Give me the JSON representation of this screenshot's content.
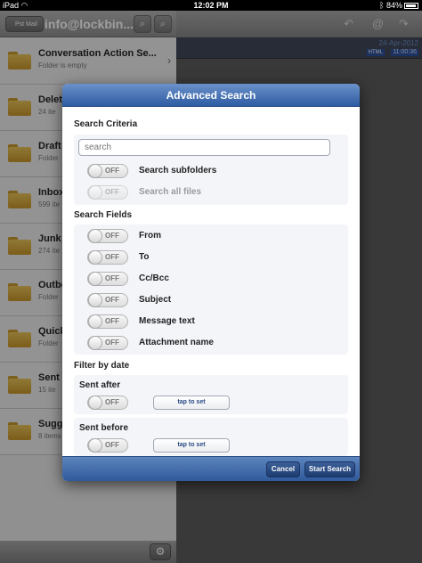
{
  "status_bar": {
    "device": "iPad",
    "time": "12:02 PM",
    "battery": "84%"
  },
  "left_pane": {
    "back_label": "Pst Mail",
    "title": "info@lockbin...",
    "folders": [
      {
        "name": "Conversation Action Se...",
        "sub": "Folder is empty"
      },
      {
        "name": "Delet",
        "sub": "24 ite"
      },
      {
        "name": "Draft",
        "sub": "Folder"
      },
      {
        "name": "Inbox",
        "sub": "599 ite"
      },
      {
        "name": "Junk",
        "sub": "274 ite"
      },
      {
        "name": "Outbo",
        "sub": "Folder"
      },
      {
        "name": "Quick",
        "sub": "Folder"
      },
      {
        "name": "Sent",
        "sub": "15 ite"
      },
      {
        "name": "Sugg",
        "sub": "8 items"
      }
    ]
  },
  "right_pane": {
    "date": "24-Apr-2012",
    "format_badge": "HTML",
    "time": "11:00:36"
  },
  "dialog": {
    "title": "Advanced Search",
    "search_criteria_label": "Search Criteria",
    "search_placeholder": "search",
    "off_label": "OFF",
    "criteria_options": [
      "Search subfolders",
      "Search all files"
    ],
    "search_fields_label": "Search Fields",
    "fields": [
      "From",
      "To",
      "Cc/Bcc",
      "Subject",
      "Message text",
      "Attachment name"
    ],
    "filter_label": "Filter by date",
    "sent_after_label": "Sent after",
    "sent_before_label": "Sent before",
    "tap_to_set": "tap to set",
    "cancel_label": "Cancel",
    "start_label": "Start Search"
  }
}
